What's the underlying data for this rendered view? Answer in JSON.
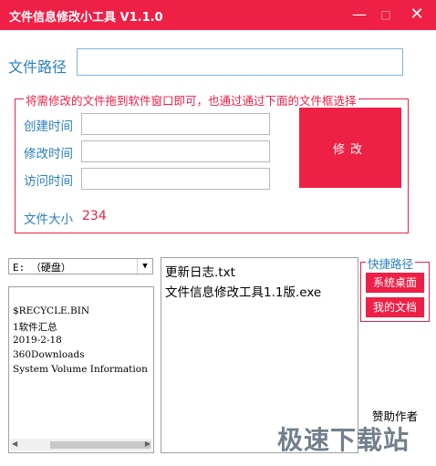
{
  "window": {
    "title": "文件信息修改小工具 V1.1.0",
    "min": "—",
    "max": "□",
    "close": "✕"
  },
  "path": {
    "label": "文件路径",
    "value": ""
  },
  "group": {
    "legend": "将需修改的文件拖到软件窗口即可，也通过通过下面的文件框选择",
    "created_label": "创建时间",
    "created_value": "",
    "modified_label": "修改时间",
    "modified_value": "",
    "accessed_label": "访问时间",
    "accessed_value": "",
    "size_label": "文件大小",
    "size_value": "234",
    "modify_button": "修改"
  },
  "drive": {
    "selected": "E: （硬盘）",
    "arrow": "▼"
  },
  "dirs": [
    "$RECYCLE.BIN",
    "1软件汇总",
    "2019-2-18",
    "360Downloads",
    "System Volume Information"
  ],
  "files": [
    "更新日志.txt",
    "文件信息修改工具1.1版.exe"
  ],
  "quick": {
    "legend": "快捷路径",
    "desktop": "系统桌面",
    "documents": "我的文档"
  },
  "sponsor": "赞助作者",
  "watermark": "极速下载站",
  "colors": {
    "accent": "#ee2046",
    "label_blue": "#2a7fc0"
  }
}
